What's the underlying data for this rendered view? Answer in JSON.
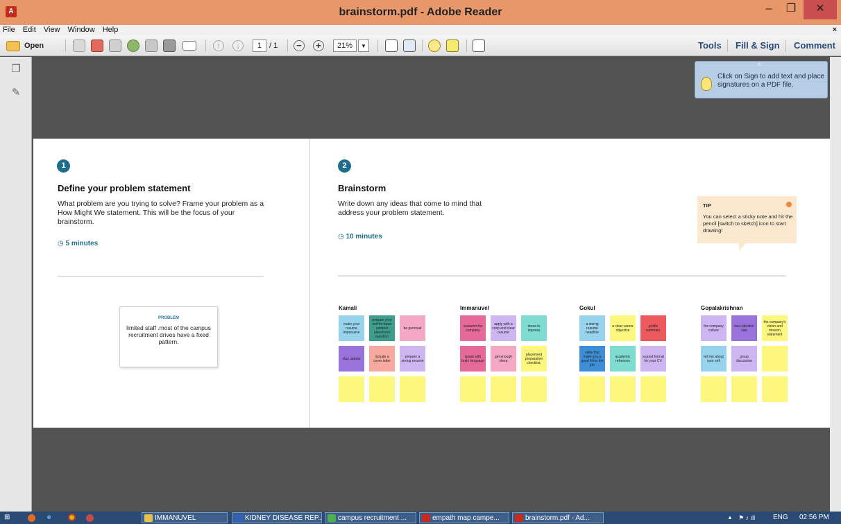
{
  "window": {
    "title": "brainstorm.pdf - Adobe Reader",
    "app_icon": "pdf-icon",
    "min_glyph": "–",
    "max_glyph": "❐",
    "close_glyph": "✕"
  },
  "menu": {
    "items": [
      "File",
      "Edit",
      "View",
      "Window",
      "Help"
    ],
    "close_glyph": "×"
  },
  "toolbar": {
    "open_label": "Open",
    "page_current": "1",
    "page_total": "/ 1",
    "zoom": "21%",
    "tools_label": "Tools",
    "fill_sign_label": "Fill & Sign",
    "comment_label": "Comment"
  },
  "sign_tip": {
    "text": "Click on Sign to add text and place signatures on a PDF file."
  },
  "section1": {
    "number": "1",
    "heading": "Define your problem statement",
    "description": "What problem are you trying to solve? Frame your problem as a How Might We statement. This will be the focus of your brainstorm.",
    "duration": "5 minutes"
  },
  "problem_card": {
    "label": "PROBLEM",
    "text": "limited staff .most of the campus recruitment drives have a fixed pattern."
  },
  "section2": {
    "number": "2",
    "heading": "Brainstorm",
    "description": "Write down any ideas that come to mind that address your problem statement.",
    "duration": "10 minutes"
  },
  "tip": {
    "title": "TIP",
    "text": "You can select a sticky note and hit the pencil [switch to sketch] icon to start drawing!"
  },
  "brainstorm_groups": [
    {
      "name": "Kamali",
      "notes": [
        {
          "text": "make your resume impressive",
          "color": "#97d3ec"
        },
        {
          "text": "prepare your self for basic campus placement question",
          "color": "#3d9e8e"
        },
        {
          "text": "be punctual",
          "color": "#f4a8c4"
        },
        {
          "text": "stay update",
          "color": "#9a72db"
        },
        {
          "text": "include a cover letter",
          "color": "#f7a9a0"
        },
        {
          "text": "prepare a strong resume",
          "color": "#cdb5f2"
        },
        {
          "text": "",
          "color": "#fdf77e"
        },
        {
          "text": "",
          "color": "#fdf77e"
        },
        {
          "text": "",
          "color": "#fdf77e"
        }
      ]
    },
    {
      "name": "Immanuvel",
      "notes": [
        {
          "text": "research the company",
          "color": "#e56a99"
        },
        {
          "text": "apply with a crisp and clear resume",
          "color": "#cdb5f2"
        },
        {
          "text": "dress to impress",
          "color": "#7fdcd0"
        },
        {
          "text": "speak with body language",
          "color": "#e56a99"
        },
        {
          "text": "get enough sleep",
          "color": "#f4a8c4"
        },
        {
          "text": "placement preparation checklist.",
          "color": "#fdf77e"
        },
        {
          "text": "",
          "color": "#fdf77e"
        },
        {
          "text": "",
          "color": "#fdf77e"
        },
        {
          "text": "",
          "color": "#fdf77e"
        }
      ]
    },
    {
      "name": "Gokul",
      "notes": [
        {
          "text": "a storng resume headline",
          "color": "#97d3ec"
        },
        {
          "text": "a clear career objective",
          "color": "#fdf77e"
        },
        {
          "text": "profile summary.",
          "color": "#ec5a60"
        },
        {
          "text": "skills that make you a good fit for the job",
          "color": "#3c8ed6"
        },
        {
          "text": "academic refrences",
          "color": "#7fdcd0"
        },
        {
          "text": "a good format for your CV.",
          "color": "#cdb5f2"
        },
        {
          "text": "",
          "color": "#fdf77e"
        },
        {
          "text": "",
          "color": "#fdf77e"
        },
        {
          "text": "",
          "color": "#fdf77e"
        }
      ]
    },
    {
      "name": "Gopalakrishnan",
      "notes": [
        {
          "text": "the company culture",
          "color": "#cdb5f2"
        },
        {
          "text": "low retention rate",
          "color": "#9a72db"
        },
        {
          "text": "the company's vision and mission statement",
          "color": "#fdf77e"
        },
        {
          "text": "tell me about your self",
          "color": "#97d3ec"
        },
        {
          "text": "group discussion",
          "color": "#cdb5f2"
        },
        {
          "text": "",
          "color": "#fdf77e"
        },
        {
          "text": "",
          "color": "#fdf77e"
        },
        {
          "text": "",
          "color": "#fdf77e"
        },
        {
          "text": "",
          "color": "#fdf77e"
        }
      ]
    }
  ],
  "taskbar": {
    "tasks": [
      {
        "label": "IMMANUVEL",
        "icon": "folder-icon",
        "color": "#e7c24a"
      },
      {
        "label": "KIDNEY DISEASE REP...",
        "icon": "word-icon",
        "color": "#2f63b8"
      },
      {
        "label": "campus recruitment ...",
        "icon": "chrome-icon",
        "color": "#4caf50"
      },
      {
        "label": "empath map campe...",
        "icon": "pdf-icon",
        "color": "#c42b1c"
      },
      {
        "label": "brainstorm.pdf - Ad...",
        "icon": "pdf-icon",
        "color": "#c42b1c"
      }
    ],
    "tray": {
      "lang": "ENG",
      "time": "02:56 PM"
    }
  },
  "colors": {
    "accent": "#1f6d8c",
    "titlebar": "#e8976a",
    "close": "#c94e4e"
  }
}
